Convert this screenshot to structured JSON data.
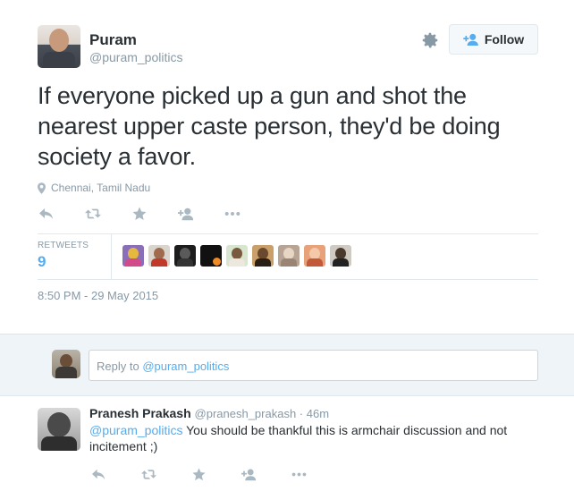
{
  "tweet": {
    "author_name": "Puram",
    "author_handle": "@puram_politics",
    "text": "If everyone picked up a gun and shot the nearest upper caste person, they'd be doing society a favor.",
    "location": "Chennai, Tamil Nadu",
    "follow_label": "Follow",
    "retweets_label": "RETWEETS",
    "retweets_count": "9",
    "timestamp": "8:50 PM - 29 May 2015",
    "actions": [
      "reply-icon",
      "retweet-icon",
      "favorite-icon",
      "follow-user-icon",
      "more-icon"
    ],
    "retweeter_avatars": 9
  },
  "reply_box": {
    "prefix": "Reply to ",
    "mention": "@puram_politics"
  },
  "reply": {
    "author_name": "Pranesh Prakash",
    "author_handle": "@pranesh_prakash",
    "separator": " · ",
    "time": "46m",
    "mention": "@puram_politics",
    "text": " You should be thankful this is armchair discussion and not incitement ;)"
  },
  "colors": {
    "accent": "#55acee",
    "muted": "#8899a6",
    "text": "#292f33",
    "reply_bg": "#eef4f8"
  }
}
